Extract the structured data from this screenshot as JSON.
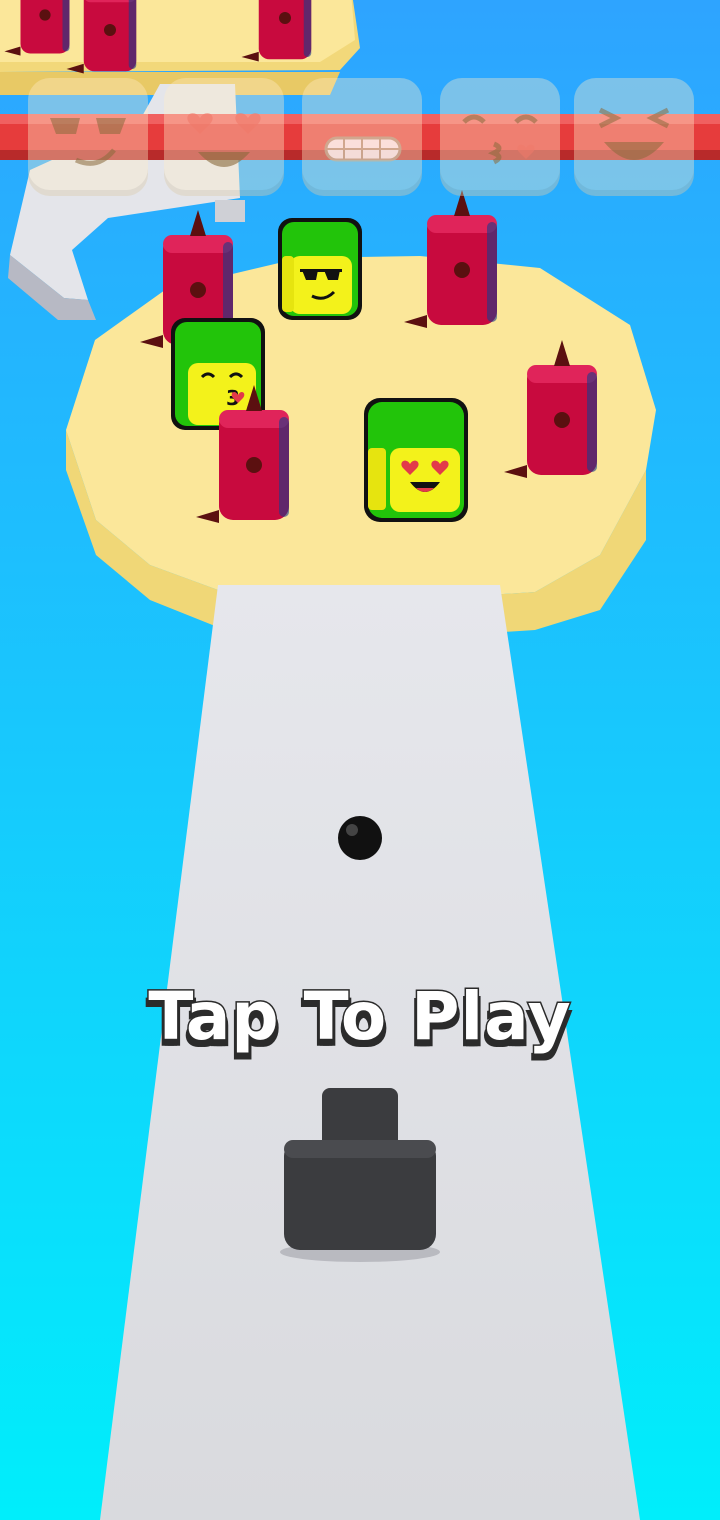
{
  "hud": {
    "emoji_slots": [
      {
        "emoji": "sunglasses-face-icon"
      },
      {
        "emoji": "heart-eyes-face-icon"
      },
      {
        "emoji": "grimacing-face-icon"
      },
      {
        "emoji": "kissing-face-icon"
      },
      {
        "emoji": "squinting-laugh-face-icon"
      }
    ]
  },
  "scene": {
    "cubes": [
      {
        "emoji": "sunglasses-face-icon"
      },
      {
        "emoji": "kissing-face-icon"
      },
      {
        "emoji": "heart-eyes-face-icon"
      }
    ],
    "spike_pillars": 7,
    "colors": {
      "sky_top": "#2ea4ff",
      "sky_bottom": "#00eefb",
      "platform": "#fbe79a",
      "platform_edge": "#f3d779",
      "path": "#dddee3",
      "cube_green": "#22c40a",
      "cube_yellow": "#f3f21b",
      "spike_pillar": "#c80a3e",
      "hud_bar": "#e63c3c"
    }
  },
  "prompt": {
    "label": "Tap To Play"
  }
}
